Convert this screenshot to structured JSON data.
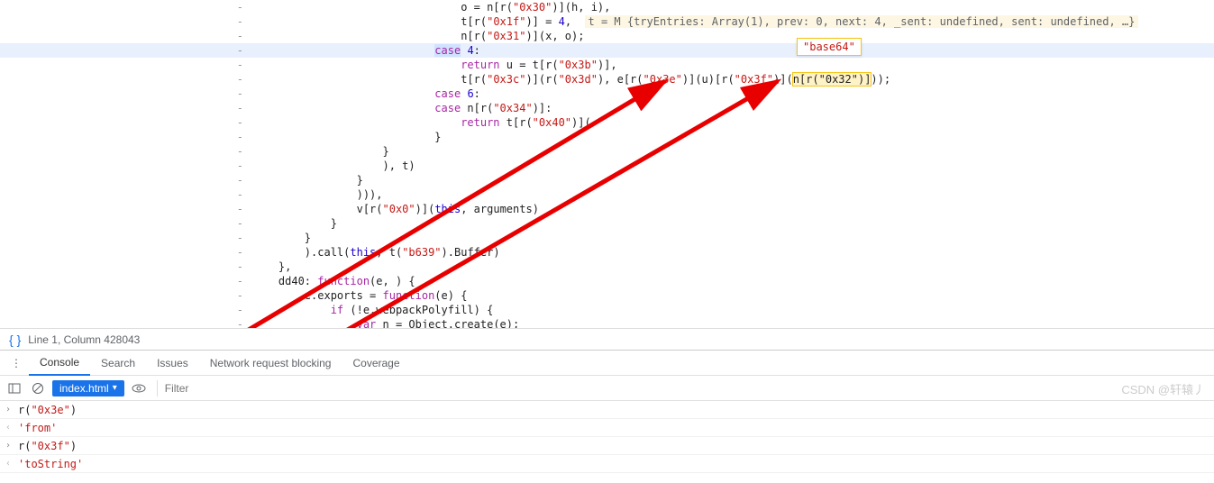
{
  "code": {
    "dashes": [
      "-",
      "-",
      "-",
      "-",
      "-",
      "-",
      "-",
      "-",
      "-",
      "-",
      "-",
      "-",
      "-",
      "-",
      "-",
      "-",
      "-",
      "-",
      "-",
      "-",
      "-",
      "-",
      "-"
    ],
    "inline_eval": "t = M {tryEntries: Array(1), prev: 0, next: 4, _sent: undefined, sent: undefined, …}",
    "tooltip": "\"base64\"",
    "l0_pre": "                                o = n[r(",
    "l0_s": "\"0x30\"",
    "l0_post": ")](h, i),",
    "l1_pre": "                                t[r(",
    "l1_s": "\"0x1f\"",
    "l1_mid": ")] = ",
    "l1_num": "4",
    "l1_c": ",",
    "l2_pre": "                                n[r(",
    "l2_s": "\"0x31\"",
    "l2_post": ")](x, o);",
    "l3_pre": "                            ",
    "l3_case": "case",
    "l3_sp": " ",
    "l3_num": "4",
    "l3_col": ":",
    "l4_pre": "                                ",
    "l4_ret": "return",
    "l4_sp": " u = t[r(",
    "l4_s": "\"0x3b\"",
    "l4_post": ")],",
    "l5_pre": "                                t[r(",
    "l5_s1": "\"0x3c\"",
    "l5_m1": ")](r(",
    "l5_s2": "\"0x3d\"",
    "l5_m2": "), e[r(",
    "l5_s3": "\"0x3e\"",
    "l5_m3": ")](u)[r(",
    "l5_s4": "\"0x3f\"",
    "l5_m4": ")](",
    "l5_hl": "n[r(\"0x32\")]",
    "l5_post": "));",
    "l6_pre": "                            ",
    "l6_case": "case",
    "l6_sp": " ",
    "l6_num": "6",
    "l6_col": ":",
    "l7_pre": "                            ",
    "l7_case": "case",
    "l7_sp": " n[r(",
    "l7_s": "\"0x34\"",
    "l7_post": ")]:",
    "l8_pre": "                                ",
    "l8_ret": "return",
    "l8_sp": " t[r(",
    "l8_s": "\"0x40\"",
    "l8_post": ")](",
    "l9": "                            }",
    "l10": "                    }",
    "l11": "                    ), t)",
    "l12": "                }",
    "l13": "                ))),",
    "l14_pre": "                v[r(",
    "l14_s": "\"0x0\"",
    "l14_m": ")](",
    "l14_this": "this",
    "l14_post": ", arguments)",
    "l15": "            }",
    "l16": "        }",
    "l17_pre": "        ).call(",
    "l17_this": "this",
    "l17_m": ", t(",
    "l17_s": "\"b639\"",
    "l17_post": ").Buffer)",
    "l18": "    },",
    "l19_pre": "    dd40: ",
    "l19_fn": "function",
    "l19_post": "(e, ",
    "l19_post2": ") {",
    "l20_pre": "        e.exports = ",
    "l20_fn": "function",
    "l20_post": "(e) {",
    "l21_pre": "            ",
    "l21_if": "if",
    "l21_post": " (!e.webpackPolyfill) {",
    "l22_pre": "                ",
    "l22_var": "var",
    "l22_post": " n = Object.create(e);"
  },
  "status": {
    "text": "Line 1, Column 428043"
  },
  "tabs": {
    "console": "Console",
    "search": "Search",
    "issues": "Issues",
    "network": "Network request blocking",
    "coverage": "Coverage"
  },
  "toolbar": {
    "context": "index.html",
    "filter_ph": "Filter"
  },
  "console": {
    "r1": "r(\"0x3e\")",
    "r2": "'from'",
    "r3": "r(\"0x3f\")",
    "r4": "'toString'"
  },
  "watermark": "CSDN @轩辕丿"
}
